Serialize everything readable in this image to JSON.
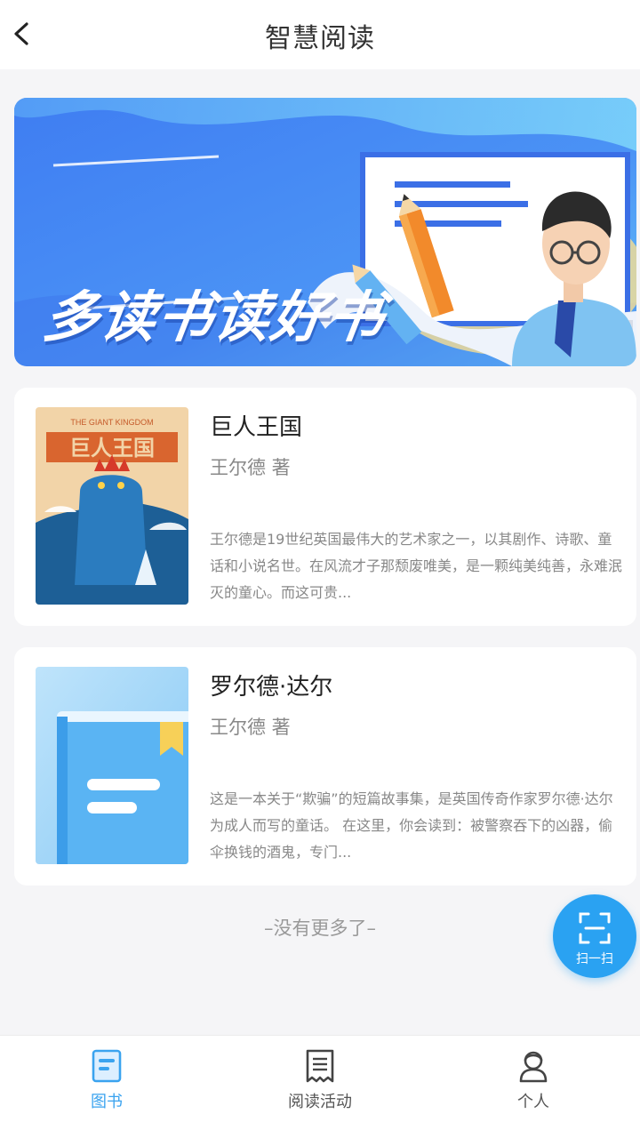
{
  "header": {
    "title": "智慧阅读",
    "back_icon": "chevron-left-icon"
  },
  "banner": {
    "slogan": "多读书读好书",
    "colors": {
      "primary": "#3a78f0",
      "secondary": "#6fd0f8"
    }
  },
  "books": [
    {
      "title": "巨人王国",
      "author": "王尔德 著",
      "cover_text": "THE GIANT KINGDOM",
      "cover_title": "巨人王国",
      "description": "王尔德是19世纪英国最伟大的艺术家之一，以其剧作、诗歌、童话和小说名世。在风流才子那颓废唯美，是一颗纯美纯善，永难泯灭的童心。而这可贵..."
    },
    {
      "title": "罗尔德·达尔",
      "author": "王尔德 著",
      "cover_icon": "book-icon",
      "description": "这是一本关于“欺骗”的短篇故事集，是英国传奇作家罗尔德·达尔为成人而写的童话。 在这里，你会读到：被警察吞下的凶器，偷伞换钱的酒鬼，专门..."
    }
  ],
  "list_footer": "–没有更多了–",
  "scan": {
    "label": "扫一扫",
    "icon": "scan-icon"
  },
  "tabbar": {
    "tabs": [
      {
        "label": "图书",
        "icon": "book-tab-icon",
        "active": true
      },
      {
        "label": "阅读活动",
        "icon": "receipt-icon",
        "active": false
      },
      {
        "label": "个人",
        "icon": "user-icon",
        "active": false
      }
    ],
    "active_color": "#3aa3ef"
  }
}
